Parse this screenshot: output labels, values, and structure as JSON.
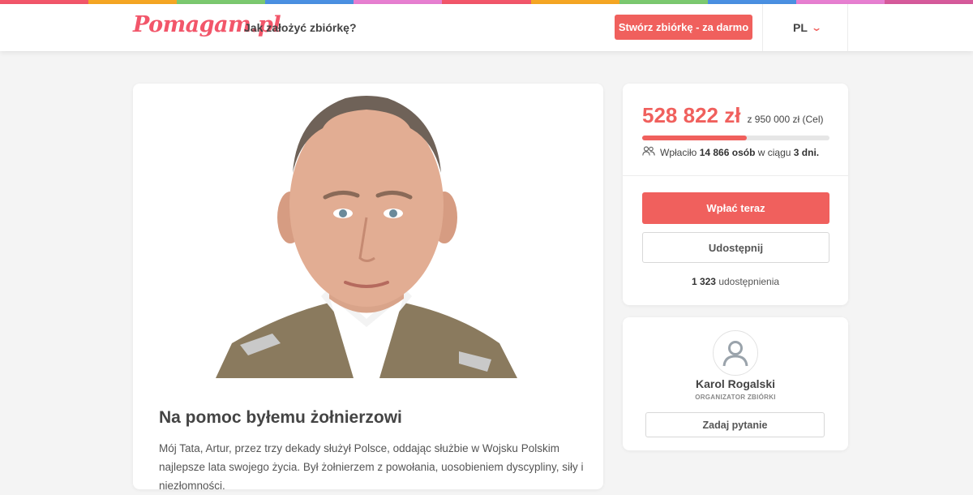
{
  "rainbow_colors": [
    "#f2566a",
    "#f5a623",
    "#7bc96f",
    "#4a90e2",
    "#e77fd1",
    "#f2566a",
    "#f5a623",
    "#7bc96f",
    "#4a90e2",
    "#e77fd1",
    "#d65a9b"
  ],
  "header": {
    "logo_text": "Pomagam.pl",
    "how_to_link": "Jak założyć zbiórkę?",
    "create_button": "Stwórz zbiórkę - za darmo",
    "language": "PL",
    "language_icon": "chevron-down-icon"
  },
  "campaign": {
    "title": "Na pomoc byłemu żołnierzowi",
    "description": "Mój Tata, Artur, przez trzy dekady służył Polsce, oddając służbie w Wojsku Polskim najlepsze lata swojego życia. Był żołnierzem z powołania, uosobieniem dyscypliny, siły i niezłomności."
  },
  "stats": {
    "amount": "528 822 zł",
    "goal": "z 950 000 zł (Cel)",
    "progress_fraction": 0.557,
    "donors_prefix": "Wpłaciło",
    "donors_count": "14 866 osób",
    "donors_mid": "w ciągu",
    "donors_days": "3 dni.",
    "pay_button": "Wpłać teraz",
    "share_button": "Udostępnij",
    "shares_count": "1 323",
    "shares_label": "udostępnienia"
  },
  "organizer": {
    "name": "Karol Rogalski",
    "role": "ORGANIZATOR ZBIÓRKI",
    "ask_button": "Zadaj pytanie"
  },
  "colors": {
    "accent": "#f0605d",
    "logo": "#f2566a"
  }
}
